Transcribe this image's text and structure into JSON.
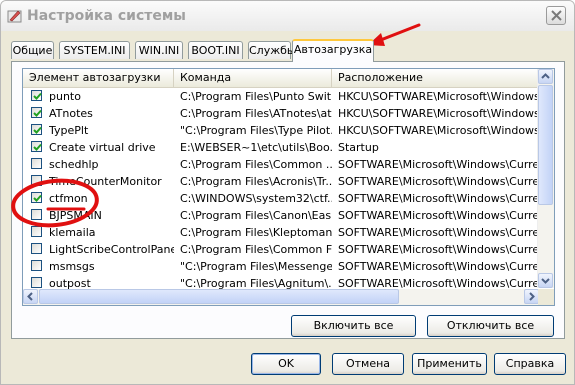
{
  "window": {
    "title": "Настройка системы"
  },
  "tabs": [
    {
      "label": "Общие"
    },
    {
      "label": "SYSTEM.INI"
    },
    {
      "label": "WIN.INI"
    },
    {
      "label": "BOOT.INI"
    },
    {
      "label": "Службы"
    },
    {
      "label": "Автозагрузка",
      "active": true
    }
  ],
  "list": {
    "columns": [
      "Элемент автозагрузки",
      "Команда",
      "Расположение"
    ],
    "rows": [
      {
        "checked": true,
        "item": "punto",
        "command": "C:\\Program Files\\Punto Swit...",
        "location": "HKCU\\SOFTWARE\\Microsoft\\Windows\\Cu"
      },
      {
        "checked": true,
        "item": "ATnotes",
        "command": "C:\\Program Files\\ATnotes\\at...",
        "location": "HKCU\\SOFTWARE\\Microsoft\\Windows\\Cu"
      },
      {
        "checked": true,
        "item": "TypePlt",
        "command": "\"C:\\Program Files\\Type Pilot...",
        "location": "HKCU\\SOFTWARE\\Microsoft\\Windows\\Cu"
      },
      {
        "checked": true,
        "item": "Create virtual drive",
        "command": "E:\\WEBSER~1\\etc\\utils\\Boo...",
        "location": "Startup"
      },
      {
        "checked": false,
        "item": "schedhlp",
        "command": "C:\\Program Files\\Common ...",
        "location": "SOFTWARE\\Microsoft\\Windows\\Currentw"
      },
      {
        "checked": false,
        "item": "TimeCounterMonitor",
        "command": "C:\\Program Files\\Acronis\\Tr...",
        "location": "SOFTWARE\\Microsoft\\Windows\\Currentw"
      },
      {
        "checked": true,
        "item": "ctfmon",
        "command": "C:\\WINDOWS\\system32\\ctf...",
        "location": "SOFTWARE\\Microsoft\\Windows\\Currentw"
      },
      {
        "checked": false,
        "item": "BJPSMAIN",
        "command": "C:\\Program Files\\Canon\\Eas...",
        "location": "SOFTWARE\\Microsoft\\Windows\\Currentw"
      },
      {
        "checked": false,
        "item": "klemaila",
        "command": "C:\\Program Files\\Kleptomani...",
        "location": "SOFTWARE\\Microsoft\\Windows\\Currentw"
      },
      {
        "checked": false,
        "item": "LightScribeControlPanel",
        "command": "C:\\Program Files\\Common Fi...",
        "location": "SOFTWARE\\Microsoft\\Windows\\Currentw"
      },
      {
        "checked": false,
        "item": "msmsgs",
        "command": "\"C:\\Program Files\\Messenge...",
        "location": "SOFTWARE\\Microsoft\\Windows\\Currentw"
      },
      {
        "checked": false,
        "item": "outpost",
        "command": "\"C:\\Program Files\\Agnitum\\...",
        "location": "SOFTWARE\\Microsoft\\Windows\\Currentw"
      }
    ]
  },
  "panel_buttons": {
    "enable_all": "Включить все",
    "disable_all": "Отключить все"
  },
  "dialog_buttons": {
    "ok": "OK",
    "cancel": "Отмена",
    "apply": "Применить",
    "help": "Справка"
  },
  "annotation_color": "#e01010"
}
